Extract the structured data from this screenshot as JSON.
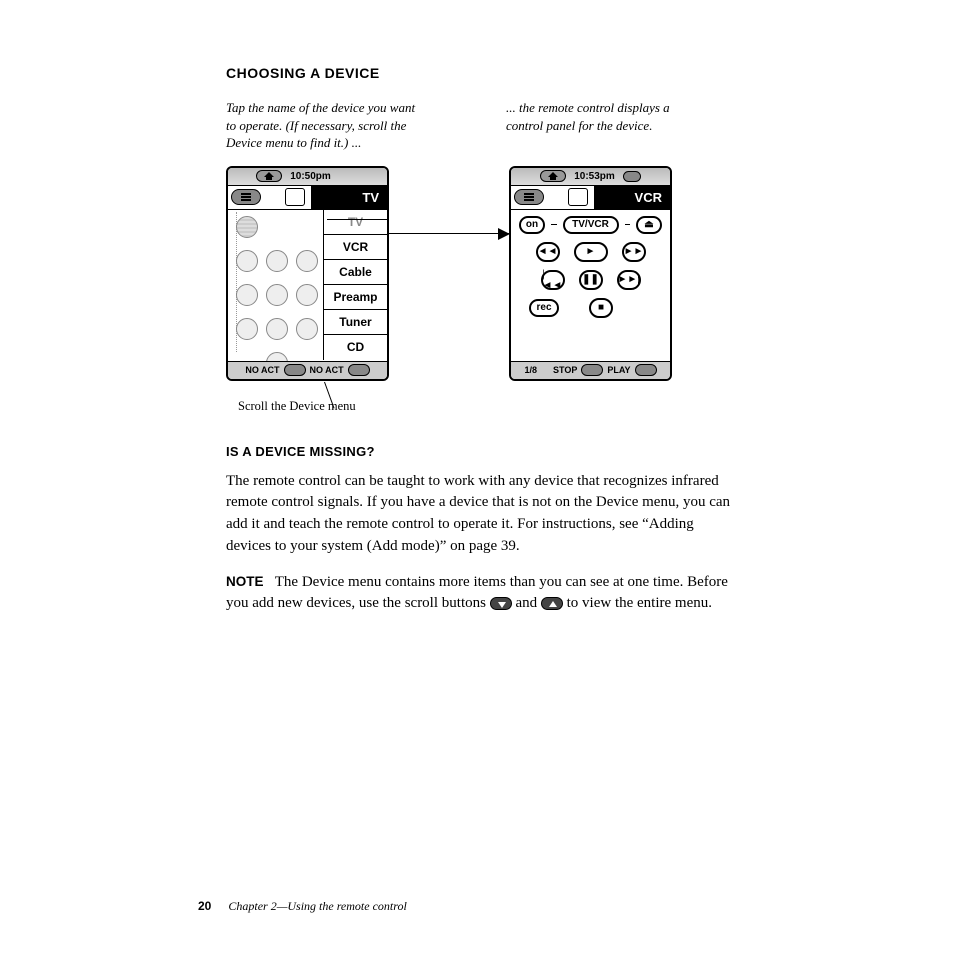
{
  "heading": "CHOOSING A DEVICE",
  "caption_left": "Tap the name of the device you want to operate. (If necessary, scroll the Device menu to find it.) ...",
  "caption_right": "... the remote control displays a control panel for the device.",
  "screen_left": {
    "time": "10:50pm",
    "device_label": "TV",
    "menu": [
      "TV",
      "VCR",
      "Cable",
      "Preamp",
      "Tuner",
      "CD"
    ],
    "footer_left": "NO ACT",
    "footer_right": "NO ACT"
  },
  "screen_right": {
    "time": "10:53pm",
    "device_label": "VCR",
    "buttons": {
      "on": "on",
      "tvvcr": "TV/VCR",
      "eject": "⏏",
      "rew": "◄◄",
      "play": "►",
      "ff": "►►",
      "prev": "|◄◄",
      "pause": "❚❚",
      "next": "►►|",
      "rec": "rec",
      "stop": "■"
    },
    "footer_left": "1/8",
    "footer_mid_l": "STOP",
    "footer_mid_r": "PLAY"
  },
  "scroll_caption": "Scroll the Device menu",
  "subheading": "IS A DEVICE MISSING?",
  "para1": "The remote control can be taught to work with any device that recognizes infrared remote control signals. If you have a device that is not on the Device menu, you can add it and teach the remote control to operate it. For instructions, see “Adding devices to your system (Add mode)” on page 39.",
  "note_label": "NOTE",
  "note_text_a": "The Device menu contains more items than you can see at one time. Before you add new devices, use the scroll buttons ",
  "note_text_b": " and ",
  "note_text_c": " to view the entire menu.",
  "footer": {
    "page": "20",
    "chapter": "Chapter 2—Using the remote control"
  }
}
